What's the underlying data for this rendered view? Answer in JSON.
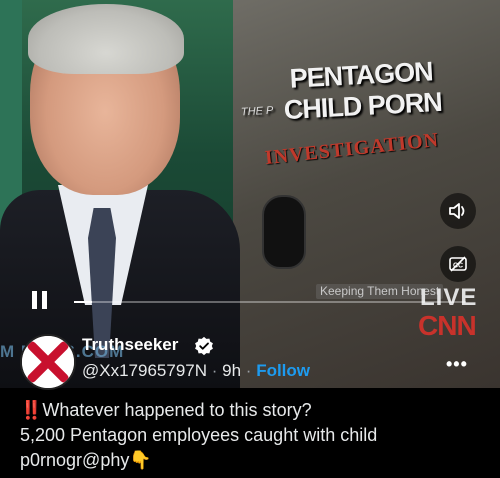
{
  "video": {
    "overlay": {
      "book_title_line1": "PENTAGON",
      "book_title_line2": "CHILD PORN",
      "book_prefix": "THE P",
      "book_subtitle": "INVESTIGATION",
      "keeping_them_honest": "Keeping Them Honest",
      "live": "LIVE",
      "network": "CNN",
      "watermark": "M NEWS.COM"
    },
    "progress": 0.045
  },
  "post": {
    "author_name": "Truthseeker",
    "handle": "@Xx17965797N",
    "time": "9h",
    "follow_label": "Follow",
    "text_line1": "Whatever happened to this story?",
    "text_line2": "5,200 Pentagon employees caught with child",
    "text_line3": "p0rnogr@phy",
    "emoji_prefix": "‼️",
    "emoji_suffix": "👇"
  },
  "colors": {
    "background": "#000000",
    "link": "#1d9bf0",
    "text": "#e7e9ea",
    "cnn_red": "#c8322b"
  }
}
